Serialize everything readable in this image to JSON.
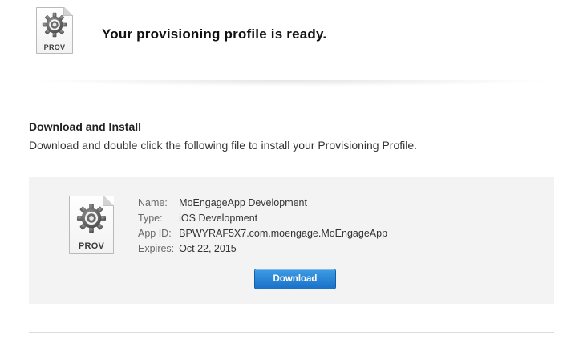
{
  "header": {
    "title": "Your provisioning profile is ready.",
    "file_icon": {
      "icon": "provisioning-file-icon",
      "extension_label": "PROV"
    }
  },
  "section": {
    "heading": "Download and Install",
    "description": "Download and double click the following file to install your Provisioning Profile."
  },
  "profile_card": {
    "file_icon": {
      "icon": "provisioning-file-icon",
      "extension_label": "PROV"
    },
    "fields": [
      {
        "label": "Name:",
        "value": "MoEngageApp Development"
      },
      {
        "label": "Type:",
        "value": "iOS Development"
      },
      {
        "label": "App ID:",
        "value": "BPWYRAF5X7.com.moengage.MoEngageApp"
      },
      {
        "label": "Expires:",
        "value": "Oct 22, 2015"
      }
    ],
    "download_label": "Download"
  },
  "colors": {
    "card_background": "#f2f3f2",
    "button_top": "#3e9be4",
    "button_bottom": "#1a71c8",
    "title_text": "#111111",
    "label_text": "#6a6a6a"
  }
}
